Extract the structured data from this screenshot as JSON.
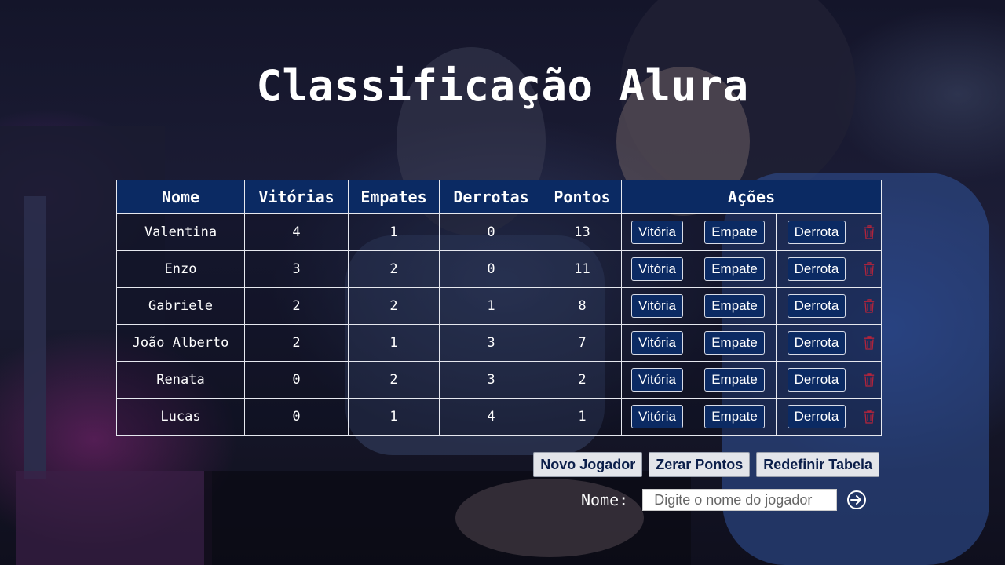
{
  "title": "Classificação Alura",
  "table": {
    "headers": {
      "name": "Nome",
      "wins": "Vitórias",
      "draws": "Empates",
      "losses": "Derrotas",
      "points": "Pontos",
      "actions": "Ações"
    },
    "rows": [
      {
        "name": "Valentina",
        "wins": "4",
        "draws": "1",
        "losses": "0",
        "points": "13"
      },
      {
        "name": "Enzo",
        "wins": "3",
        "draws": "2",
        "losses": "0",
        "points": "11"
      },
      {
        "name": "Gabriele",
        "wins": "2",
        "draws": "2",
        "losses": "1",
        "points": "8"
      },
      {
        "name": "João Alberto",
        "wins": "2",
        "draws": "1",
        "losses": "3",
        "points": "7"
      },
      {
        "name": "Renata",
        "wins": "0",
        "draws": "2",
        "losses": "3",
        "points": "2"
      },
      {
        "name": "Lucas",
        "wins": "0",
        "draws": "1",
        "losses": "4",
        "points": "1"
      }
    ],
    "action_labels": {
      "win": "Vitória",
      "draw": "Empate",
      "loss": "Derrota"
    },
    "delete_icon": "trash-icon"
  },
  "footer": {
    "new_player": "Novo Jogador",
    "reset_points": "Zerar Pontos",
    "reset_table": "Redefinir Tabela"
  },
  "form": {
    "label": "Nome:",
    "placeholder": "Digite o nome do jogador",
    "value": "",
    "submit_icon": "arrow-circle-right-icon"
  },
  "colors": {
    "header_bg": "#0b2a63",
    "button_bg": "#0b2a63",
    "delete": "#b3243b",
    "footer_button_bg": "#e3e5ea",
    "footer_button_text": "#0b1e4a"
  }
}
